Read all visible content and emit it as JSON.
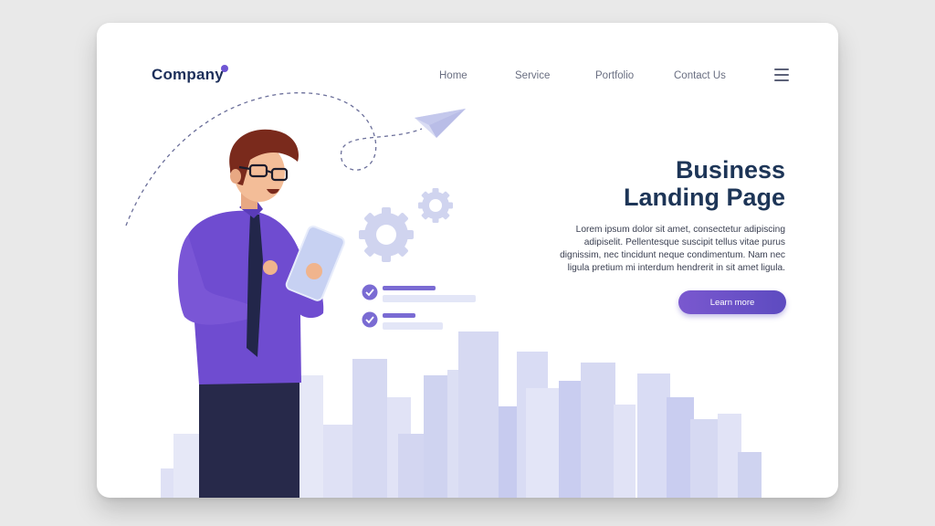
{
  "header": {
    "logo": "Company",
    "nav": [
      "Home",
      "Service",
      "Portfolio",
      "Contact Us"
    ]
  },
  "hero": {
    "title_lines": [
      "Business",
      "Landing Page"
    ],
    "description_lines": [
      "Lorem ipsum dolor sit amet, consectetur adipiscing",
      "adipiselit. Pellentesque suscipit tellus vitae purus",
      "dignissim, nec tincidunt neque condimentum. Nam nec",
      "ligula pretium mi interdum hendrerit in sit amet ligula."
    ],
    "cta_label": "Learn more"
  },
  "icons": [
    "menu-icon",
    "gear-icon",
    "check-icon",
    "paper-plane-icon"
  ],
  "colors": {
    "background": "#e9e9e9",
    "card": "#ffffff",
    "accent": "#6f56d4",
    "title": "#1d3557",
    "city": "#d6d9f2"
  }
}
